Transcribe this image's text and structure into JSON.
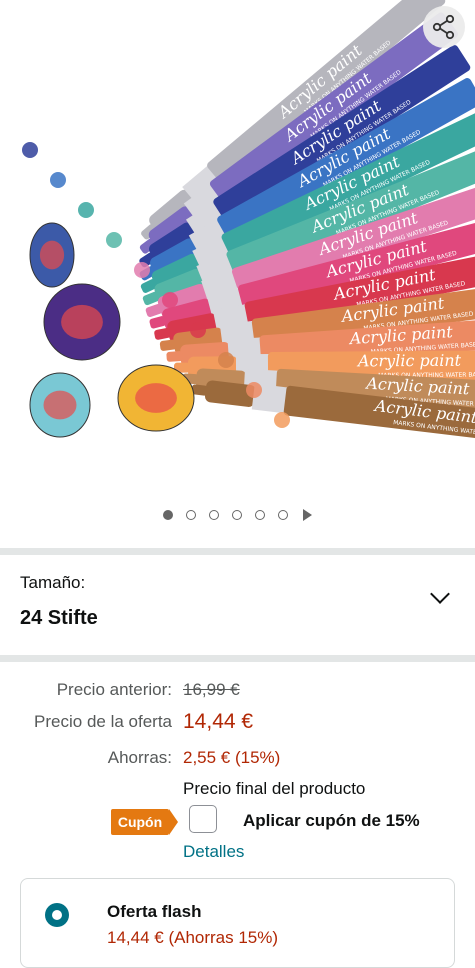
{
  "gallery": {
    "image_alt": "Acrylic paint markers",
    "marker_print": "Acrylic paint",
    "marker_sub": "MARKS ON ANYTHING WATER BASED",
    "dots_total": 6,
    "dot_active": 0,
    "colors": {
      "markers": [
        "#b6b6bd",
        "#7c6cc0",
        "#2f3f9a",
        "#3a74c4",
        "#3aa7a0",
        "#54b6a6",
        "#e27cae",
        "#e0487d",
        "#d8384e",
        "#d5824c",
        "#ec8a63",
        "#f29b5d",
        "#c08b5a",
        "#9b6a3c"
      ],
      "accent": "#b12704",
      "link": "#007185",
      "coupon": "#e47911"
    }
  },
  "size": {
    "label": "Tamaño:",
    "value": "24 Stifte"
  },
  "pricing": {
    "previous_label": "Precio anterior:",
    "previous_value": "16,99 €",
    "deal_label": "Precio de la oferta",
    "deal_value": "14,44 €",
    "savings_label": "Ahorras:",
    "savings_value": "2,55 € (15%)",
    "final_note": "Precio final del producto"
  },
  "coupon": {
    "badge": "Cupón",
    "text": "Aplicar cupón de 15%",
    "details_link": "Detalles"
  },
  "flash": {
    "title": "Oferta flash",
    "price": "14,44 € (Ahorras 15%)"
  }
}
